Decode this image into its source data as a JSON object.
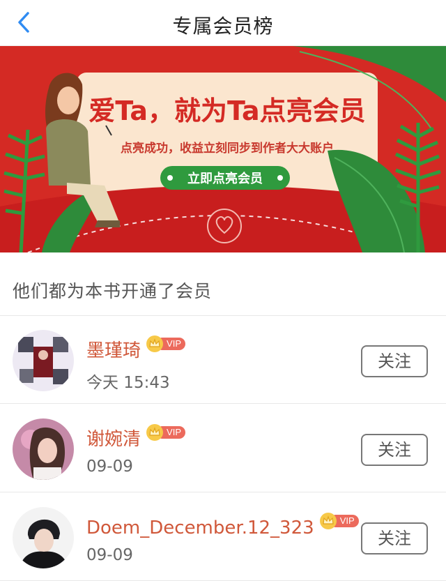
{
  "header": {
    "title": "专属会员榜",
    "back_icon": "chevron-left-icon"
  },
  "banner": {
    "headline": "爱Ta，就为Ta点亮会员",
    "subline": "点亮成功，收益立刻同步到作者大大账户",
    "cta": "立即点亮会员",
    "colors": {
      "background": "#d42a24",
      "card": "#fbe6cf",
      "leaf": "#2e8b3a",
      "cta": "#2f9a3e",
      "headline": "#d42a24"
    }
  },
  "section": {
    "title": "他们都为本书开通了会员"
  },
  "members": [
    {
      "name": "墨瑾琦",
      "time": "今天 15:43",
      "vip": "VIP",
      "follow_label": "关注"
    },
    {
      "name": "谢婉清",
      "time": "09-09",
      "vip": "VIP",
      "follow_label": "关注"
    },
    {
      "name": "Doem_December.12_323",
      "time": "09-09",
      "vip": "VIP",
      "follow_label": "关注"
    }
  ],
  "colors": {
    "name": "#d0583a",
    "vip_pill": "#ec6a5c",
    "crown": "#f7c948",
    "back_icon": "#2f8bf2"
  }
}
